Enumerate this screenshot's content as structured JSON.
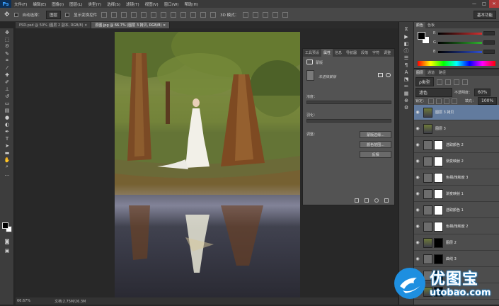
{
  "app": {
    "logo": "Ps"
  },
  "menu": [
    "文件(F)",
    "编辑(E)",
    "图像(I)",
    "图层(L)",
    "类型(Y)",
    "选择(S)",
    "滤镜(T)",
    "视图(V)",
    "窗口(W)",
    "帮助(H)"
  ],
  "window_controls": [
    "—",
    "□",
    "✕"
  ],
  "options": {
    "auto_select_label": "自动选择：",
    "auto_select_value": "图层",
    "show_transform_label": "显示变换控件",
    "mode_3d_label": "3D 模式：",
    "workspace": "基本功能"
  },
  "tabs": [
    {
      "label": "PSD.psd @ 50% (图层 2 副本, RGB/8) ×"
    },
    {
      "label": "原图.jpg @ 66.7% (图层 3 拷贝, RGB/8) ×"
    }
  ],
  "status": {
    "zoom": "66.67%",
    "doc": "文档:2.75M/26.3M"
  },
  "properties": {
    "tabs": [
      "工具预设",
      "属性",
      "信息",
      "导航器",
      "段落",
      "字符",
      "调整"
    ],
    "active_tab": "属性",
    "header_label": "蒙版",
    "subtitle": "未选择蒙版",
    "density_label": "浓度：",
    "feather_label": "羽化：",
    "refine_label": "调整：",
    "buttons": [
      "蒙版边缘...",
      "颜色范围...",
      "反相"
    ]
  },
  "color_panel": {
    "tabs": [
      "颜色",
      "色板"
    ],
    "channels": [
      {
        "label": "R",
        "value": "",
        "color": "#d23030"
      },
      {
        "label": "G",
        "value": "",
        "color": "#30b030"
      },
      {
        "label": "B",
        "value": "",
        "color": "#3050d0"
      }
    ]
  },
  "layers_panel": {
    "tabs": [
      "图层",
      "通道",
      "路径"
    ],
    "filter_label": "ρ类型",
    "blend_mode": "滤色",
    "opacity_label": "不透明度：",
    "opacity_value": "60%",
    "lock_label": "锁定：",
    "fill_label": "填充：",
    "fill_value": "100%",
    "layers": [
      {
        "name": "图层 3 拷贝",
        "selected": true,
        "thumb": "photo",
        "mask": "none"
      },
      {
        "name": "图层 3",
        "selected": false,
        "thumb": "photo",
        "mask": "none"
      },
      {
        "name": "选取颜色 2",
        "selected": false,
        "thumb": "adj",
        "mask": "white"
      },
      {
        "name": "渐变映射 2",
        "selected": false,
        "thumb": "adj",
        "mask": "white"
      },
      {
        "name": "色相/饱和度 3",
        "selected": false,
        "thumb": "adj",
        "mask": "white"
      },
      {
        "name": "渐变映射 1",
        "selected": false,
        "thumb": "adj",
        "mask": "white"
      },
      {
        "name": "选取颜色 1",
        "selected": false,
        "thumb": "adj",
        "mask": "white"
      },
      {
        "name": "色相/饱和度 2",
        "selected": false,
        "thumb": "adj",
        "mask": "white"
      },
      {
        "name": "图层 2",
        "selected": false,
        "thumb": "photo",
        "mask": "black"
      },
      {
        "name": "曲线 3",
        "selected": false,
        "thumb": "adj",
        "mask": "black"
      },
      {
        "name": "曲线 2",
        "selected": false,
        "thumb": "adj",
        "mask": "black"
      },
      {
        "name": "背景 副本2",
        "selected": false,
        "thumb": "photo",
        "mask": "black"
      }
    ]
  },
  "watermark": {
    "title": "优图宝",
    "url": "utobao.com"
  }
}
